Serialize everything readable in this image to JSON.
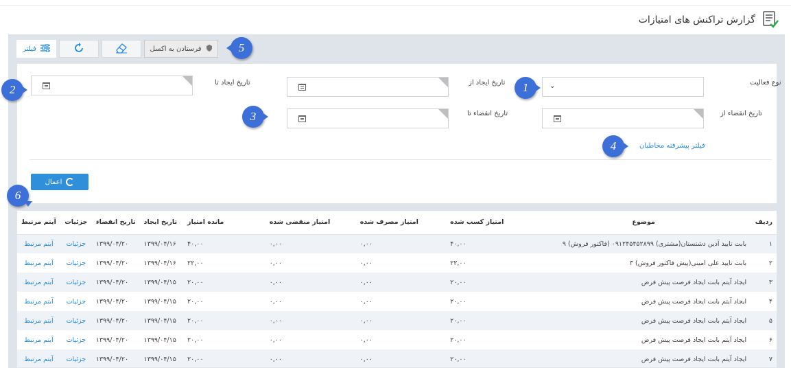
{
  "header": {
    "title": "گزارش تراکنش های امتیازات",
    "icon": "report-icon"
  },
  "toolbar": {
    "filter_label": "فیلتر",
    "excel_label": "فرستادن به اکسل"
  },
  "filters": {
    "activity_type_label": "نوع فعالیت",
    "created_from_label": "تاریخ ایجاد از",
    "created_to_label": "تاریخ ایجاد تا",
    "expire_from_label": "تاریخ انقضاء از",
    "expire_to_label": "تاریخ انقضاء تا",
    "advanced_link": "فیلتر پیشرفته مخاطبان",
    "apply_label": "اعمال"
  },
  "markers": [
    "1",
    "2",
    "3",
    "4",
    "5",
    "6"
  ],
  "table": {
    "headers": {
      "idx": "ردیف",
      "subject": "موضوع",
      "earned": "امتیاز کسب شده",
      "spent": "امتیاز مصرف شده",
      "expired": "امتیاز منقضی شده",
      "remaining": "مانده امتیاز",
      "created": "تاریخ ایجاد",
      "expires": "تاریخ انقضاء",
      "details": "جزئیات",
      "related": "آیتم مرتبط"
    },
    "rows": [
      {
        "idx": "۱",
        "subject": "بابت تایید آذین دشتستان(مشتری) ۰۹۱۲۴۵۴۵۲۸۹۹ (فاکتور فروش) ۹",
        "earned": "۴۰,۰۰",
        "spent": "۰,۰۰",
        "expired": "۰,۰۰",
        "remaining": "۴۰,۰۰",
        "created": "۱۳۹۹/۰۴/۱۶",
        "expires": "۱۳۹۹/۰۴/۲۰",
        "details": "جزئیات",
        "related": "آیتم مرتبط"
      },
      {
        "idx": "۲",
        "subject": "بابت تایید علی امینی(پیش فاکتور فروش) ۳",
        "earned": "۲۲,۰۰",
        "spent": "۰,۰۰",
        "expired": "۰,۰۰",
        "remaining": "۲۲,۰۰",
        "created": "۱۳۹۹/۰۴/۱۶",
        "expires": "۱۳۹۹/۰۴/۲۰",
        "details": "جزئیات",
        "related": "آیتم مرتبط"
      },
      {
        "idx": "۳",
        "subject": "ایجاد آیتم بابت ایجاد فرصت پیش فرض",
        "earned": "۲۰,۰۰",
        "spent": "۰,۰۰",
        "expired": "۰,۰۰",
        "remaining": "۲۰,۰۰",
        "created": "۱۳۹۹/۰۴/۱۵",
        "expires": "۱۳۹۹/۰۴/۲۰",
        "details": "جزئیات",
        "related": "آیتم مرتبط"
      },
      {
        "idx": "۴",
        "subject": "ایجاد آیتم بابت ایجاد فرصت پیش فرض",
        "earned": "۲۰,۰۰",
        "spent": "۰,۰۰",
        "expired": "۰,۰۰",
        "remaining": "۲۰,۰۰",
        "created": "۱۳۹۹/۰۴/۱۵",
        "expires": "۱۳۹۹/۰۴/۲۰",
        "details": "جزئیات",
        "related": "آیتم مرتبط"
      },
      {
        "idx": "۵",
        "subject": "ایجاد آیتم بابت ایجاد فرصت پیش فرض",
        "earned": "۲۰,۰۰",
        "spent": "۰,۰۰",
        "expired": "۰,۰۰",
        "remaining": "۲۰,۰۰",
        "created": "۱۳۹۹/۰۴/۱۵",
        "expires": "۱۳۹۹/۰۴/۲۰",
        "details": "جزئیات",
        "related": "آیتم مرتبط"
      },
      {
        "idx": "۶",
        "subject": "ایجاد آیتم بابت ایجاد فرصت پیش فرض",
        "earned": "۲۰,۰۰",
        "spent": "۰,۰۰",
        "expired": "۰,۰۰",
        "remaining": "۲۰,۰۰",
        "created": "۱۳۹۹/۰۴/۱۵",
        "expires": "۱۳۹۹/۰۴/۲۰",
        "details": "جزئیات",
        "related": "آیتم مرتبط"
      },
      {
        "idx": "۷",
        "subject": "ایجاد آیتم بابت ایجاد فرصت پیش فرض",
        "earned": "۲۰,۰۰",
        "spent": "۰,۰۰",
        "expired": "۰,۰۰",
        "remaining": "۲۰,۰۰",
        "created": "۱۳۹۹/۰۴/۱۵",
        "expires": "۱۳۹۹/۰۴/۲۰",
        "details": "جزئیات",
        "related": "آیتم مرتبط"
      }
    ]
  },
  "colors": {
    "accent": "#1e88e5",
    "marker": "#3d6fd8",
    "panel": "#dfe3ea",
    "row_alt": "#eff2f6"
  }
}
